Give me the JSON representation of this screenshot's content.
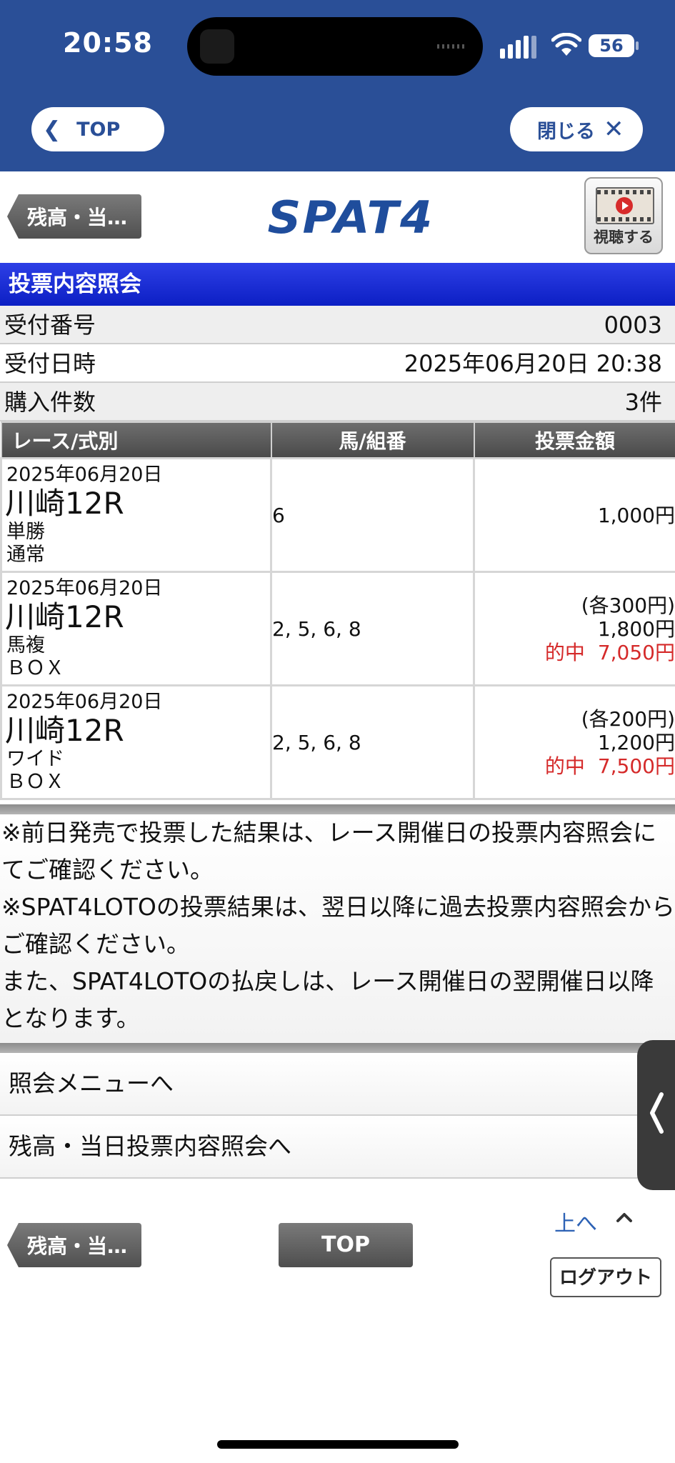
{
  "status_bar": {
    "time": "20:58",
    "battery": "56"
  },
  "nav": {
    "top_label": "TOP",
    "close_label": "閉じる"
  },
  "header": {
    "back_label": "残高・当…",
    "logo": "SPAT4",
    "video_label": "視聴する"
  },
  "section_title": "投票内容照会",
  "info": {
    "receipt_no_label": "受付番号",
    "receipt_no": "0003",
    "received_at_label": "受付日時",
    "received_at": "2025年06月20日 20:38",
    "count_label": "購入件数",
    "count": "3件"
  },
  "table": {
    "headers": [
      "レース/式別",
      "馬/組番",
      "投票金額"
    ],
    "rows": [
      {
        "date": "2025年06月20日",
        "race": "川崎12R",
        "bet_type": "単勝",
        "method": "通常",
        "combo": "6",
        "unit": "",
        "amount": "1,000円",
        "hit_label": "",
        "payout": ""
      },
      {
        "date": "2025年06月20日",
        "race": "川崎12R",
        "bet_type": "馬複",
        "method": "ＢＯＸ",
        "combo": "2, 5, 6, 8",
        "unit": "(各300円)",
        "amount": "1,800円",
        "hit_label": "的中",
        "payout": "7,050円"
      },
      {
        "date": "2025年06月20日",
        "race": "川崎12R",
        "bet_type": "ワイド",
        "method": "ＢＯＸ",
        "combo": "2, 5, 6, 8",
        "unit": "(各200円)",
        "amount": "1,200円",
        "hit_label": "的中",
        "payout": "7,500円"
      }
    ]
  },
  "notes": [
    "※前日発売で投票した結果は、レース開催日の投票内容照会にてご確認ください。",
    "※SPAT4LOTOの投票結果は、翌日以降に過去投票内容照会からご確認ください。",
    "また、SPAT4LOTOの払戻しは、レース開催日の翌開催日以降となります。"
  ],
  "menu": {
    "inquiry_menu": "照会メニューへ",
    "balance_inquiry": "残高・当日投票内容照会へ"
  },
  "footer": {
    "back_label": "残高・当…",
    "top_label": "TOP",
    "up_label": "上へ",
    "logout_label": "ログアウト"
  },
  "colors": {
    "nav_blue": "#2a4f97",
    "title_blue": "#1428d8",
    "hit_red": "#d52a2a"
  }
}
